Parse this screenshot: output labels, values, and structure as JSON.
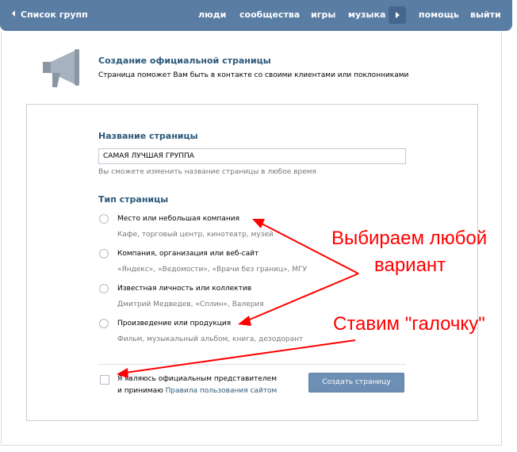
{
  "nav": {
    "back_label": "Список групп",
    "links": [
      "люди",
      "сообщества",
      "игры",
      "музыка",
      "помощь",
      "выйти"
    ]
  },
  "header": {
    "title": "Создание официальной страницы",
    "subtitle": "Страница поможет Вам быть в контакте со своими клиентами или поклонниками"
  },
  "form": {
    "name_label": "Название страницы",
    "name_value": "САМАЯ ЛУЧШАЯ ГРУППА",
    "name_hint": "Вы сможете изменить название страницы в любое время",
    "type_label": "Тип страницы",
    "options": [
      {
        "label": "Место или небольшая компания",
        "desc": "Кафе, торговый центр, кинотеатр, музей"
      },
      {
        "label": "Компания, организация или веб-сайт",
        "desc": "«Яндекс», «Ведомости», «Врачи без границ», МГУ"
      },
      {
        "label": "Известная личность или коллектив",
        "desc": "Дмитрий Медведев, «Сплин», Валерия"
      },
      {
        "label": "Произведение или продукция",
        "desc": "Фильм, музыкальный альбом, книга, дезодорант"
      }
    ],
    "agreement_line1": "Я являюсь официальным представителем",
    "agreement_line2_prefix": "и принимаю ",
    "agreement_link": "Правила пользования сайтом",
    "create_button": "Создать страницу"
  },
  "annotations": {
    "choose_line1": "Выбираем любой",
    "choose_line2": "вариант",
    "check": "Ставим \"галочку\"",
    "color": "#ff0000"
  },
  "colors": {
    "topbar": "#597da3",
    "link": "#2b587a",
    "button": "#6d8fb3"
  }
}
